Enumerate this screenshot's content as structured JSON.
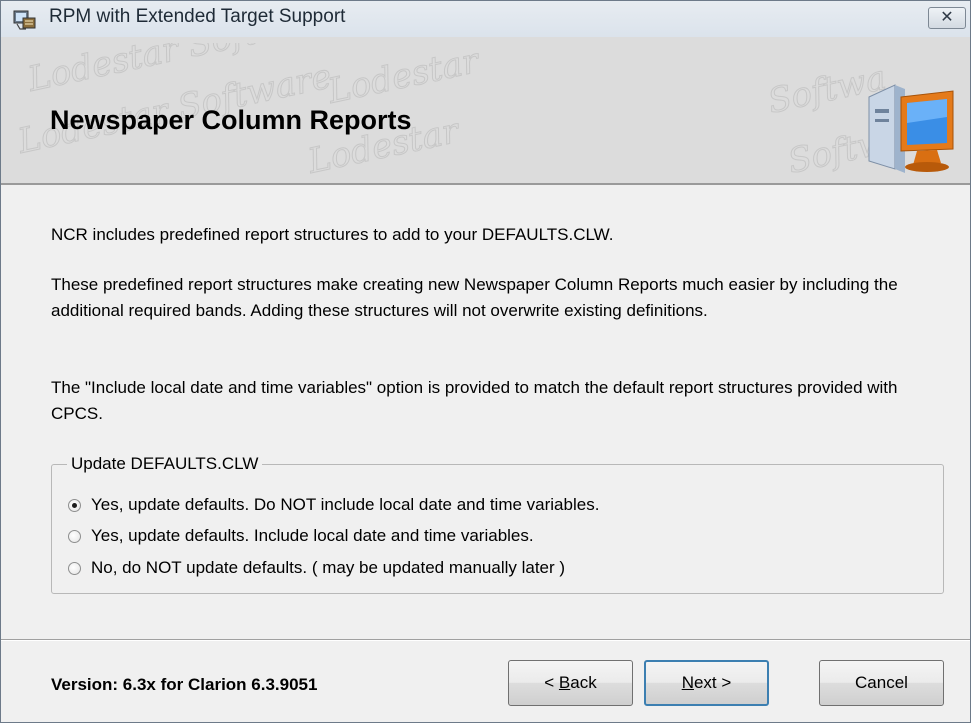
{
  "window": {
    "title": "RPM with Extended Target Support",
    "close_label": "✕",
    "app_icon": "installer-icon"
  },
  "banner": {
    "title": "Newspaper Column Reports",
    "watermark_text": "Lodestar Software",
    "icon": "computer-icon"
  },
  "content": {
    "paragraph1": "NCR includes predefined report structures to add to your DEFAULTS.CLW.",
    "paragraph2": "These predefined report structures make creating new Newspaper Column Reports much easier by including the additional required bands. Adding these structures will not overwrite existing definitions.",
    "paragraph3": "The \"Include local date and time variables\" option is provided to match the default report structures provided with CPCS."
  },
  "group": {
    "legend": "Update DEFAULTS.CLW",
    "options": [
      {
        "label": "Yes, update defaults. Do NOT include local date and time variables.",
        "selected": true
      },
      {
        "label": "Yes, update defaults. Include local date and time variables.",
        "selected": false
      },
      {
        "label": "No, do NOT update defaults. ( may be updated manually later )",
        "selected": false
      }
    ]
  },
  "footer": {
    "version": "Version: 6.3x for Clarion 6.3.9051",
    "back_prefix": "< ",
    "back_access": "B",
    "back_rest": "ack",
    "next_access": "N",
    "next_rest": "ext >",
    "cancel_label": "Cancel"
  }
}
